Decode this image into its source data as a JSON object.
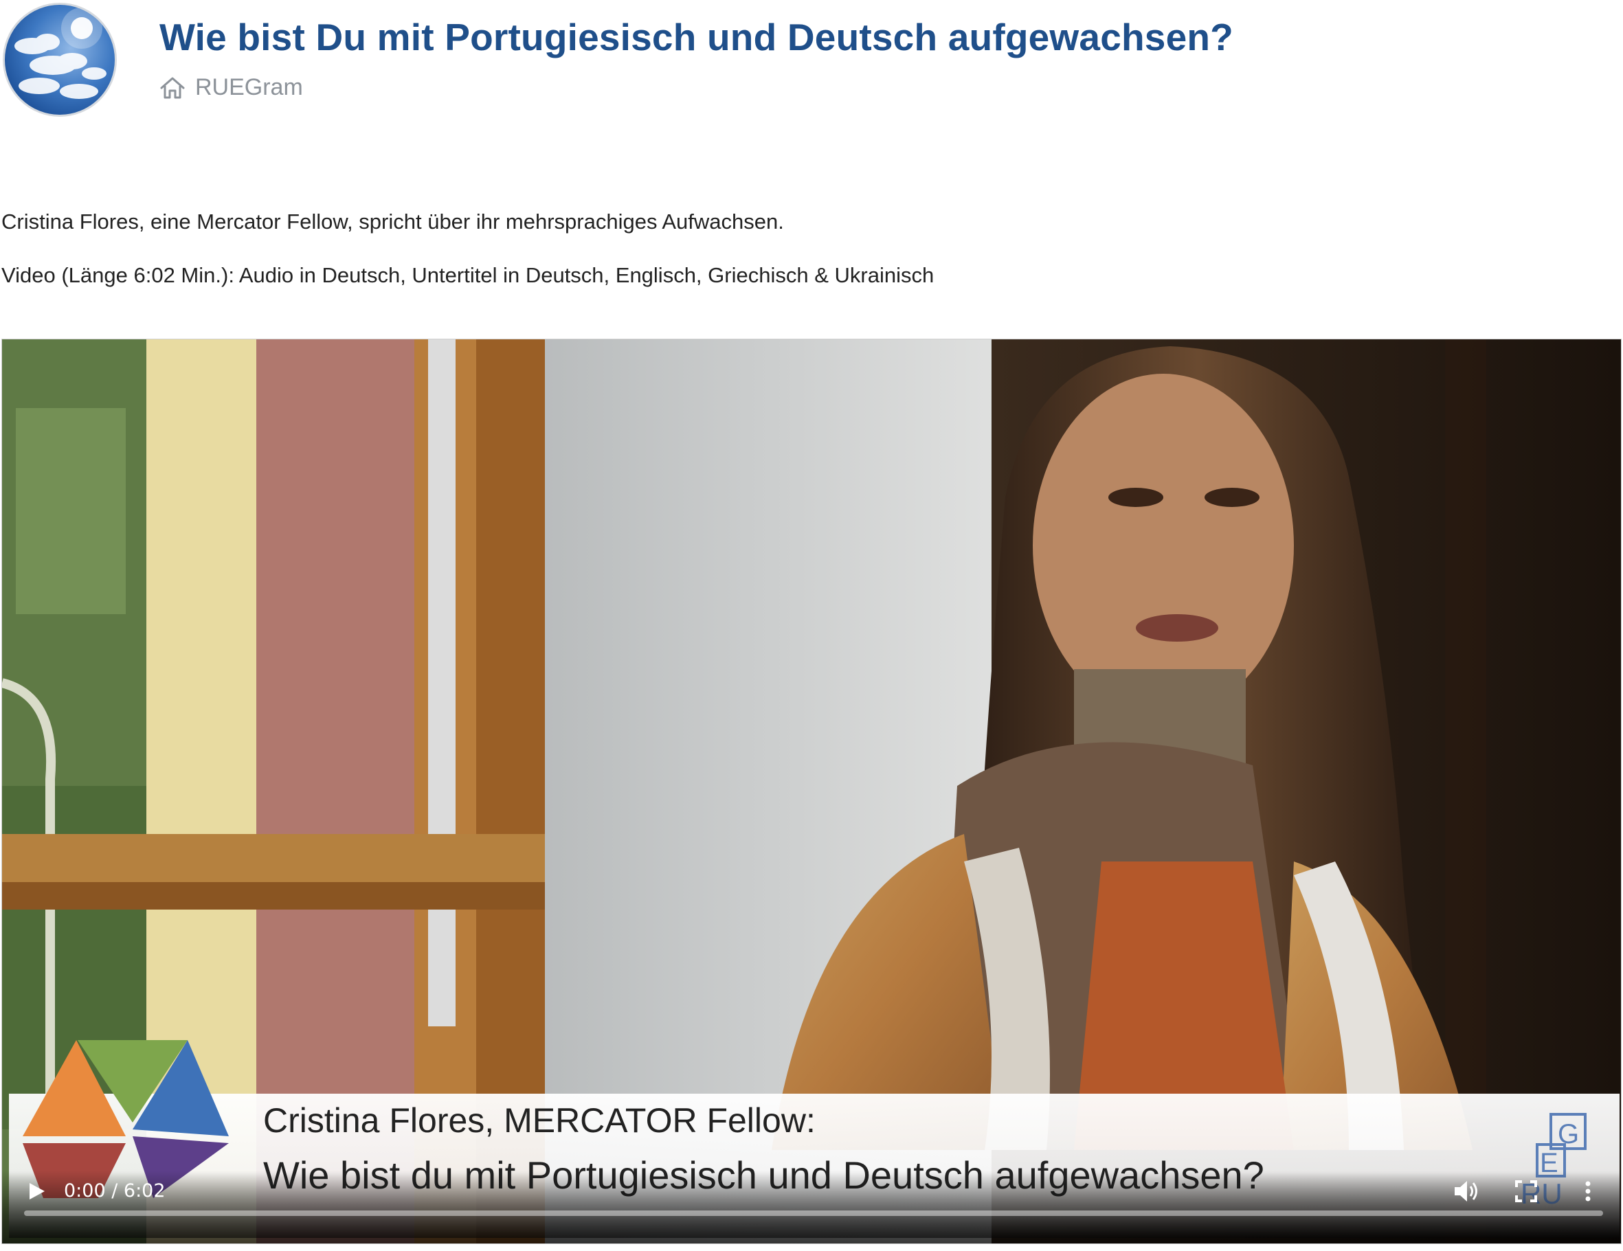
{
  "header": {
    "title": "Wie bist Du mit Portugiesisch und Deutsch aufgewachsen?",
    "breadcrumb_label": "RUEGram",
    "home_icon": "home-icon",
    "avatar_icon": "sky-clouds-avatar"
  },
  "content": {
    "description": "Cristina Flores, eine Mercator Fellow, spricht über ihr mehrsprachiges Aufwachsen.",
    "video_info": "Video (Länge 6:02 Min.): Audio in Deutsch, Untertitel in Deutsch, Englisch, Griechisch & Ukrainisch"
  },
  "video": {
    "lower_third_line1": "Cristina Flores, MERCATOR Fellow:",
    "lower_third_line2": "Wie bist du mit Portugiesisch und Deutsch aufgewachsen?",
    "logo_text": "RUEG",
    "controls": {
      "time": "0:00 / 6:02",
      "progress": 0,
      "play_icon": "play-icon",
      "volume_icon": "volume-icon",
      "fullscreen_icon": "fullscreen-icon",
      "more_icon": "more-options-icon"
    }
  },
  "colors": {
    "title": "#1f4f8a",
    "breadcrumb": "#8c9299",
    "text": "#222222"
  }
}
